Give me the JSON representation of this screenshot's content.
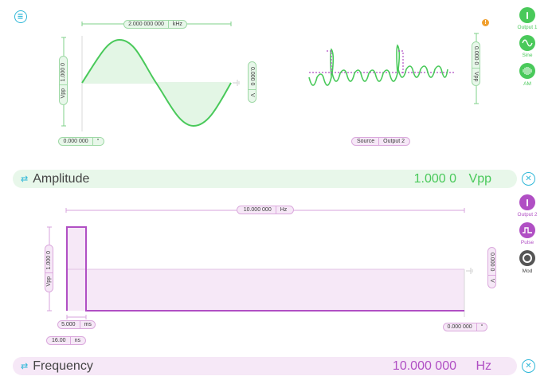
{
  "channel1": {
    "freq_value": "2.000 000 000",
    "freq_unit": "kHz",
    "amp_value": "1.000 0",
    "amp_unit": "Vpp",
    "offset_value": "0.000 0",
    "offset_unit": "V",
    "phase_value": "0.000 000",
    "phase_unit": "°",
    "mod_amp_value": "0.000 0",
    "mod_amp_unit": "Vpp",
    "source_label": "Source",
    "source_value": "Output 2",
    "output_label": "Output 1",
    "waveform_label": "Sine",
    "mod_label": "AM",
    "param_label": "Amplitude",
    "param_value": "1.000 0",
    "param_unit": "Vpp",
    "color": "#49c95a"
  },
  "channel2": {
    "freq_value": "10.000 000",
    "freq_unit": "Hz",
    "amp_value": "1.000 0",
    "amp_unit": "Vpp",
    "offset_value": "0.000 0",
    "offset_unit": "V",
    "width_value": "5.000",
    "width_unit": "ms",
    "edge_value": "16.00",
    "edge_unit": "ns",
    "phase_value": "0.000 000",
    "phase_unit": "°",
    "output_label": "Output 2",
    "waveform_label": "Pulse",
    "mod_label": "Mod",
    "param_label": "Frequency",
    "param_value": "10.000 000",
    "param_unit": "Hz",
    "color": "#b04fc4"
  },
  "icons": {
    "menu": "menu-icon",
    "warning": "warning-icon",
    "power": "power-icon",
    "sine": "sine-wave-icon",
    "am": "am-modulation-icon",
    "pulse": "pulse-wave-icon",
    "mod": "mod-ring-icon",
    "swap": "swap-arrows-icon",
    "tools": "tools-icon",
    "ground": "ground-icon"
  }
}
